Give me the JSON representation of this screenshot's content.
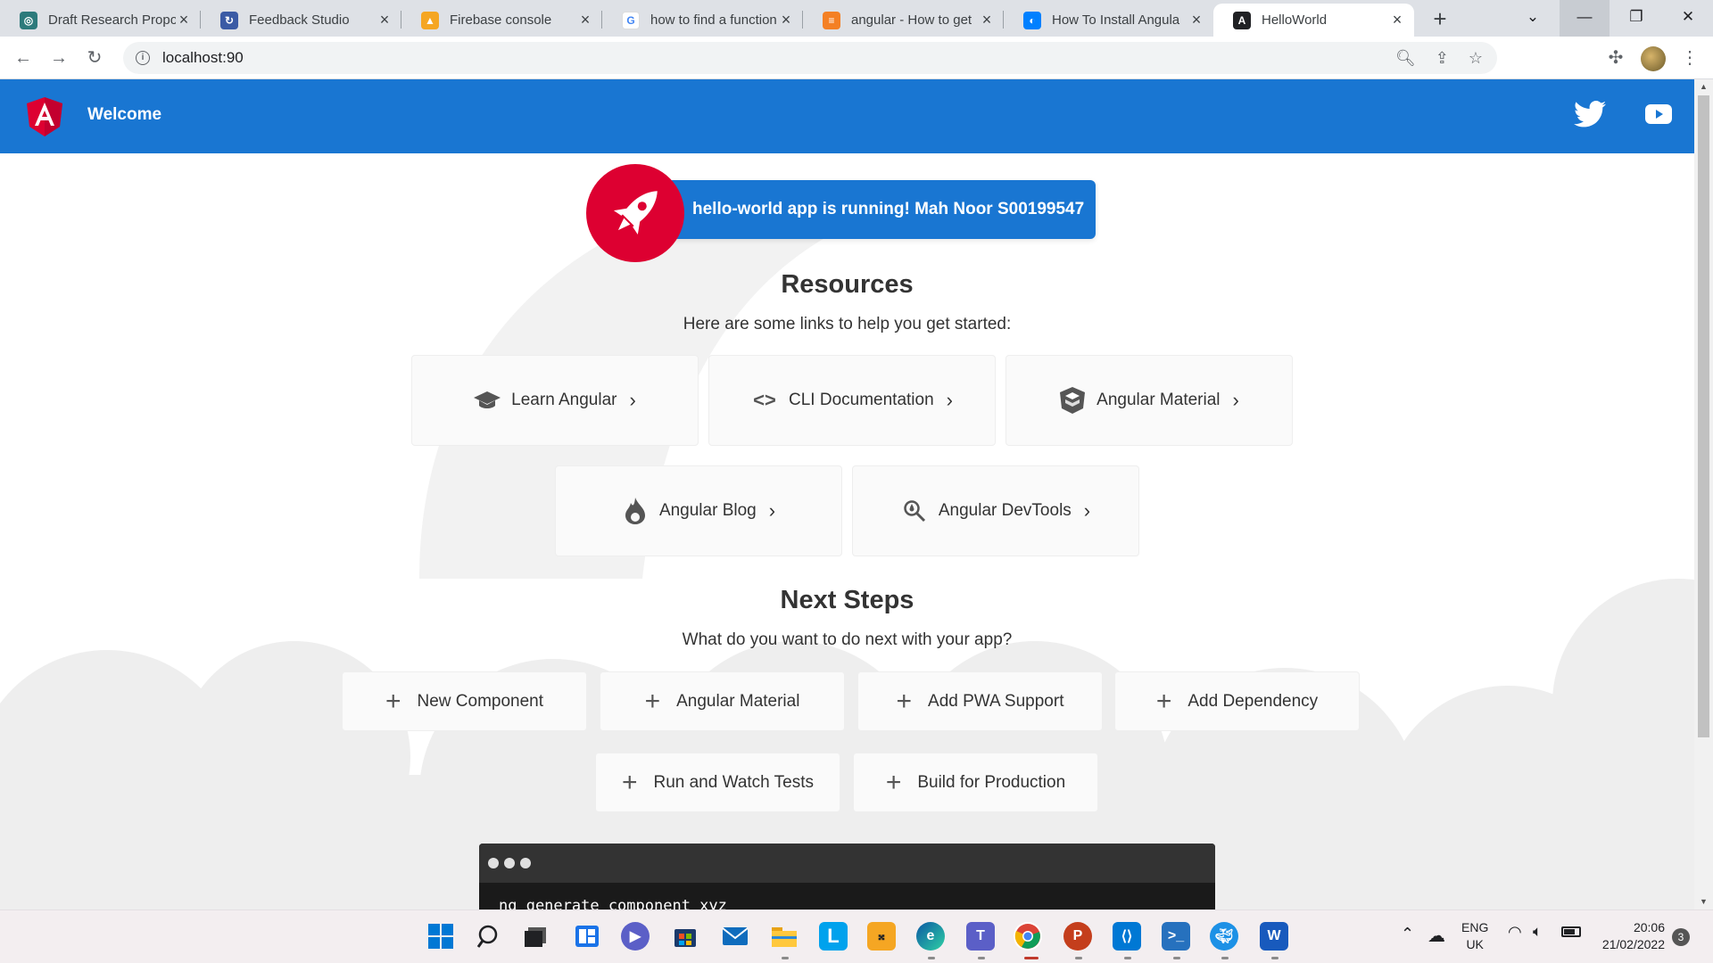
{
  "browser": {
    "tabs": [
      {
        "title": "Draft Research Propo",
        "icon": "research-favicon",
        "color": "#2c7a7b"
      },
      {
        "title": "Feedback Studio",
        "icon": "feedback-studio-favicon",
        "color": "#3b5ba5"
      },
      {
        "title": "Firebase console",
        "icon": "firebase-favicon",
        "color": "#f5a623"
      },
      {
        "title": "how to find a function",
        "icon": "google-favicon",
        "color": "#4285f4"
      },
      {
        "title": "angular - How to get",
        "icon": "stackoverflow-favicon",
        "color": "#f48024"
      },
      {
        "title": "How To Install Angula",
        "icon": "digitalocean-favicon",
        "color": "#0080ff"
      },
      {
        "title": "HelloWorld",
        "icon": "angular-favicon",
        "color": "#202124"
      }
    ],
    "url": "localhost:90"
  },
  "app": {
    "header_title": "Welcome",
    "running_message": "hello-world app is running! Mah Noor S00199547",
    "resources_title": "Resources",
    "resources_subtitle": "Here are some links to help you get started:",
    "resources": [
      {
        "label": "Learn Angular",
        "icon": "graduation-cap-icon"
      },
      {
        "label": "CLI Documentation",
        "icon": "code-brackets-icon"
      },
      {
        "label": "Angular Material",
        "icon": "material-hexagon-icon"
      },
      {
        "label": "Angular Blog",
        "icon": "flame-icon"
      },
      {
        "label": "Angular DevTools",
        "icon": "devtools-magnifier-icon"
      }
    ],
    "next_steps_title": "Next Steps",
    "next_steps_subtitle": "What do you want to do next with your app?",
    "next_steps": [
      {
        "label": "New Component"
      },
      {
        "label": "Angular Material"
      },
      {
        "label": "Add PWA Support"
      },
      {
        "label": "Add Dependency"
      },
      {
        "label": "Run and Watch Tests"
      },
      {
        "label": "Build for Production"
      }
    ],
    "terminal_command": "ng generate component xyz",
    "colors": {
      "primary": "#1976d2",
      "accent": "#dd0031"
    }
  },
  "taskbar": {
    "language": "ENG",
    "region": "UK",
    "time": "20:06",
    "date": "21/02/2022",
    "notification_count": "3"
  }
}
